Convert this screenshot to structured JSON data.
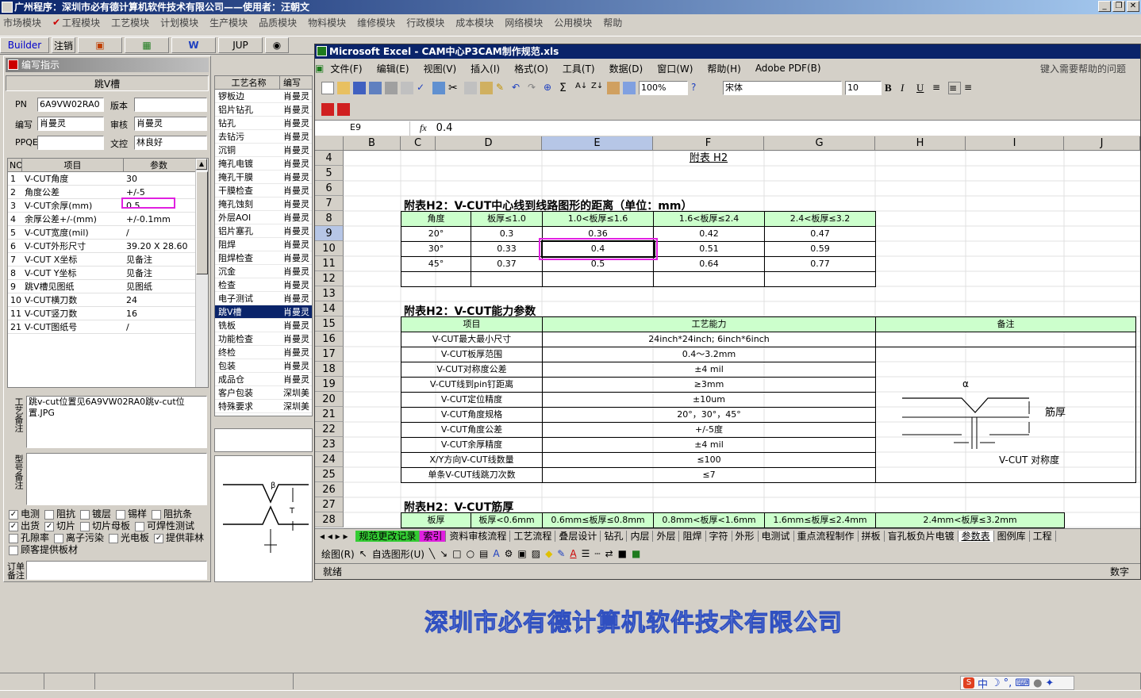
{
  "app": {
    "title": "广州程序：深圳市必有德计算机软件技术有限公司——使用者：汪朝文",
    "window_buttons": [
      "_",
      "❐",
      "✕"
    ]
  },
  "main_menu": [
    "市场模块",
    "工程模块",
    "工艺模块",
    "计划模块",
    "生产模块",
    "品质模块",
    "物料模块",
    "维修模块",
    "行政模块",
    "成本模块",
    "网络模块",
    "公用模块",
    "帮助"
  ],
  "toolbar": {
    "builder": "Builder",
    "logout": "注销",
    "jup": "JUP"
  },
  "left_panel": {
    "title": "编写指示",
    "name": "跳V槽",
    "pn_label": "PN",
    "pn_value": "6A9VW02RA0",
    "version_label": "版本",
    "version_value": "",
    "writer_label": "编写",
    "writer_value": "肖曼灵",
    "review_label": "审核",
    "review_value": "肖曼灵",
    "ppqe_label": "PPQE",
    "ppqe_value": "",
    "control_label": "文控",
    "control_value": "林良好",
    "grid_headers": [
      "NO",
      "项目",
      "参数"
    ],
    "rows": [
      {
        "no": "1",
        "item": "V-CUT角度",
        "param": "30"
      },
      {
        "no": "2",
        "item": "角度公差",
        "param": "+/-5"
      },
      {
        "no": "3",
        "item": "V-CUT余厚(mm)",
        "param": "0.5"
      },
      {
        "no": "4",
        "item": "余厚公差+/-(mm)",
        "param": "+/-0.1mm"
      },
      {
        "no": "5",
        "item": "V-CUT宽度(mil)",
        "param": "/"
      },
      {
        "no": "6",
        "item": "V-CUT外形尺寸",
        "param": "39.20 X 28.60"
      },
      {
        "no": "7",
        "item": "V-CUT X坐标",
        "param": "见备注"
      },
      {
        "no": "8",
        "item": "V-CUT Y坐标",
        "param": "见备注"
      },
      {
        "no": "9",
        "item": "跳V槽见图纸",
        "param": "见图纸"
      },
      {
        "no": "10",
        "item": "V-CUT横刀数",
        "param": "24"
      },
      {
        "no": "11",
        "item": "V-CUT竖刀数",
        "param": "16"
      },
      {
        "no": "21",
        "item": "V-CUT图纸号",
        "param": "/"
      }
    ],
    "process_note_label": "工艺备注",
    "process_note": "跳v-cut位置见6A9VW02RA0跳v-cut位置.JPG",
    "model_note_label": "型号备注",
    "model_note": "",
    "checkboxes": [
      [
        {
          "label": "电测",
          "checked": true
        },
        {
          "label": "阻抗",
          "checked": false
        },
        {
          "label": "镀层",
          "checked": false
        },
        {
          "label": "锡样",
          "checked": false
        },
        {
          "label": "阻抗条",
          "checked": false
        }
      ],
      [
        {
          "label": "出货",
          "checked": true
        },
        {
          "label": "切片",
          "checked": true
        },
        {
          "label": "切片母板",
          "checked": false
        },
        {
          "label": "可焊性测试",
          "checked": false
        }
      ],
      [
        {
          "label": "孔隙率",
          "checked": false
        },
        {
          "label": "离子污染",
          "checked": false
        },
        {
          "label": "光电板",
          "checked": false
        },
        {
          "label": "提供菲林",
          "checked": true
        }
      ],
      [
        {
          "label": "顾客提供板材",
          "checked": false
        }
      ]
    ],
    "order_note_label": "订单备注"
  },
  "process_list": {
    "headers": [
      "工艺名称",
      "编写"
    ],
    "rows": [
      [
        "锣板边",
        "肖曼灵"
      ],
      [
        "铝片钻孔",
        "肖曼灵"
      ],
      [
        "钻孔",
        "肖曼灵"
      ],
      [
        "去钻污",
        "肖曼灵"
      ],
      [
        "沉铜",
        "肖曼灵"
      ],
      [
        "掩孔电镀",
        "肖曼灵"
      ],
      [
        "掩孔干膜",
        "肖曼灵"
      ],
      [
        "干膜检查",
        "肖曼灵"
      ],
      [
        "掩孔蚀刻",
        "肖曼灵"
      ],
      [
        "外层AOI",
        "肖曼灵"
      ],
      [
        "铝片塞孔",
        "肖曼灵"
      ],
      [
        "阻焊",
        "肖曼灵"
      ],
      [
        "阻焊检查",
        "肖曼灵"
      ],
      [
        "沉金",
        "肖曼灵"
      ],
      [
        "检查",
        "肖曼灵"
      ],
      [
        "电子测试",
        "肖曼灵"
      ],
      [
        "跳V槽",
        "肖曼灵"
      ],
      [
        "铣板",
        "肖曼灵"
      ],
      [
        "功能检查",
        "肖曼灵"
      ],
      [
        "终检",
        "肖曼灵"
      ],
      [
        "包装",
        "肖曼灵"
      ],
      [
        "成品仓",
        "肖曼灵"
      ],
      [
        "客户包装",
        "深圳美"
      ],
      [
        "特殊要求",
        "深圳美"
      ]
    ],
    "selected": "跳V槽"
  },
  "excel": {
    "title": "Microsoft Excel - CAM中心P3CAM制作规范.xls",
    "menu": [
      "文件(F)",
      "编辑(E)",
      "视图(V)",
      "插入(I)",
      "格式(O)",
      "工具(T)",
      "数据(D)",
      "窗口(W)",
      "帮助(H)",
      "Adobe PDF(B)"
    ],
    "help_prompt": "键入需要帮助的问题",
    "zoom": "100%",
    "font": "宋体",
    "font_size": "10",
    "name_box": "E9",
    "formula": "0.4",
    "columns": [
      "B",
      "C",
      "D",
      "E",
      "F",
      "G",
      "H",
      "I",
      "J"
    ],
    "rows": [
      "4",
      "5",
      "6",
      "7",
      "8",
      "9",
      "10",
      "11",
      "12",
      "13",
      "14",
      "15",
      "16",
      "17",
      "18",
      "19",
      "20",
      "21",
      "22",
      "23",
      "24",
      "25",
      "26",
      "27",
      "28"
    ],
    "sheet_title": "附表 H2",
    "section1": "附表H2：V-CUT中心线到线路图形的距离（单位：mm）",
    "table1_headers": [
      "角度",
      "板厚≤1.0",
      "1.0<板厚≤1.6",
      "1.6<板厚≤2.4",
      "2.4<板厚≤3.2"
    ],
    "table1_rows": [
      [
        "20°",
        "0.3",
        "0.36",
        "0.42",
        "0.47"
      ],
      [
        "30°",
        "0.33",
        "0.4",
        "0.51",
        "0.59"
      ],
      [
        "45°",
        "0.37",
        "0.5",
        "0.64",
        "0.77"
      ]
    ],
    "section2": "附表H2：V-CUT能力参数",
    "table2_headers": [
      "项目",
      "工艺能力",
      "备注"
    ],
    "table2_rows": [
      [
        "V-CUT最大最小尺寸",
        "24inch*24inch; 6inch*6inch"
      ],
      [
        "V-CUT板厚范围",
        "0.4～3.2mm"
      ],
      [
        "V-CUT对称度公差",
        "±4 mil"
      ],
      [
        "V-CUT线到pin钉距离",
        "≥3mm"
      ],
      [
        "V-CUT定位精度",
        "±10um"
      ],
      [
        "V-CUT角度规格",
        "20°，30°，45°"
      ],
      [
        "V-CUT角度公差",
        "+/-5度"
      ],
      [
        "V-CUT余厚精度",
        "±4 mil"
      ],
      [
        "X/Y方向V-CUT线数量",
        "≤100"
      ],
      [
        "单条V-CUT线跳刀次数",
        "≤7"
      ]
    ],
    "diagram": {
      "alpha": "α",
      "thickness": "筋厚",
      "symmetry": "V-CUT 对称度"
    },
    "section3": "附表H2：V-CUT筋厚",
    "table3_headers": [
      "板厚",
      "板厚<0.6mm",
      "0.6mm≤板厚≤0.8mm",
      "0.8mm<板厚<1.6mm",
      "1.6mm≤板厚≤2.4mm",
      "2.4mm<板厚≤3.2mm"
    ],
    "tabs": [
      "规范更改记录",
      "索引",
      "资料审核流程",
      "工艺流程",
      "叠层设计",
      "钻孔",
      "内层",
      "外层",
      "阻焊",
      "字符",
      "外形",
      "电测试",
      "重点流程制作",
      "拼板",
      "盲孔板负片电镀",
      "参数表",
      "图例库",
      "工程"
    ],
    "draw_label": "绘图(R)",
    "autoshape_label": "自选图形(U)",
    "status": "就绪",
    "status_right": "数字"
  },
  "company_banner": "深圳市必有德计算机软件技术有限公司",
  "ime": {
    "label": "中"
  }
}
